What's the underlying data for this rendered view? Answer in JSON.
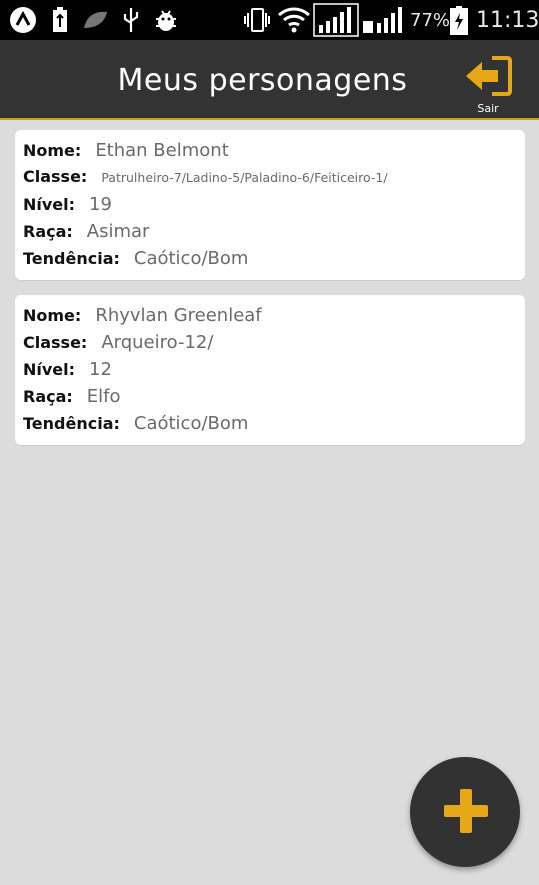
{
  "status_bar": {
    "battery": "77%",
    "time": "11:13",
    "icons": [
      "arrow-up-icon",
      "battery-usb-icon",
      "leaf-icon",
      "usb-icon",
      "bug-icon",
      "vibrate-icon",
      "wifi-icon",
      "signal-icon",
      "signal-icon-2",
      "battery-charging-icon"
    ]
  },
  "header": {
    "title": "Meus personagens",
    "logout_label": "Sair",
    "logout_icon": "logout-icon"
  },
  "labels": {
    "nome": "Nome:",
    "classe": "Classe:",
    "nivel": "Nível:",
    "raca": "Raça:",
    "tendencia": "Tendência:"
  },
  "characters": [
    {
      "nome": "Ethan Belmont",
      "classe": "Patrulheiro-7/Ladino-5/Paladino-6/Feiticeiro-1/",
      "nivel": "19",
      "raca": "Asimar",
      "tendencia": "Caótico/Bom"
    },
    {
      "nome": "Rhyvlan Greenleaf",
      "classe": "Arqueiro-12/",
      "nivel": "12",
      "raca": "Elfo",
      "tendencia": "Caótico/Bom"
    }
  ],
  "fab": {
    "icon": "plus-icon"
  },
  "colors": {
    "accent": "#e6a817",
    "appbar": "#333333",
    "background": "#dcdcdc",
    "card": "#ffffff"
  }
}
